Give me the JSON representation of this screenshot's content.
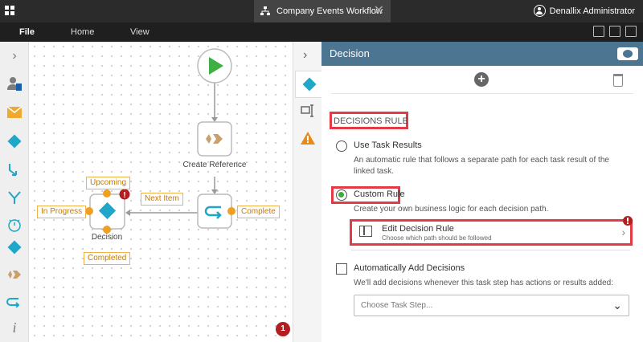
{
  "topbar": {
    "document_tab": "Company Events Workflow",
    "close_glyph": "✕",
    "user_name": "Denallix Administrator"
  },
  "menu": {
    "items": [
      "File",
      "Home",
      "View"
    ],
    "active": "File"
  },
  "canvas": {
    "nodes": {
      "create_reference": "Create Reference",
      "decision": "Decision"
    },
    "tags": {
      "upcoming": "Upcoming",
      "in_progress": "In Progress",
      "completed": "Completed",
      "next_item": "Next Item",
      "complete": "Complete"
    },
    "error_count": "1"
  },
  "strip": {
    "chevron": "›"
  },
  "panel": {
    "title": "Decision",
    "add_glyph": "+",
    "section_title": "DECISIONS RULE",
    "options": {
      "task_results": {
        "label": "Use Task Results",
        "description": "An automatic rule that follows a separate path for each task result of the linked task."
      },
      "custom_rule": {
        "label": "Custom Rule",
        "description": "Create your own business logic for each decision path."
      }
    },
    "edit_rule": {
      "title": "Edit Decision Rule",
      "subtitle": "Choose which path should be followed",
      "chevron": "›"
    },
    "auto_add": {
      "label": "Automatically Add Decisions",
      "description": "We'll add decisions whenever this task step has actions or results added:"
    },
    "task_step_select": {
      "placeholder": "Choose Task Step...",
      "caret": "⌄"
    }
  },
  "colors": {
    "accent_teal": "#1fa7c9",
    "start_green": "#3cb043",
    "highlight_red": "#e53945",
    "tag_orange": "#f0a020",
    "header_blue": "#4b7591",
    "warning_orange": "#e8891a"
  }
}
